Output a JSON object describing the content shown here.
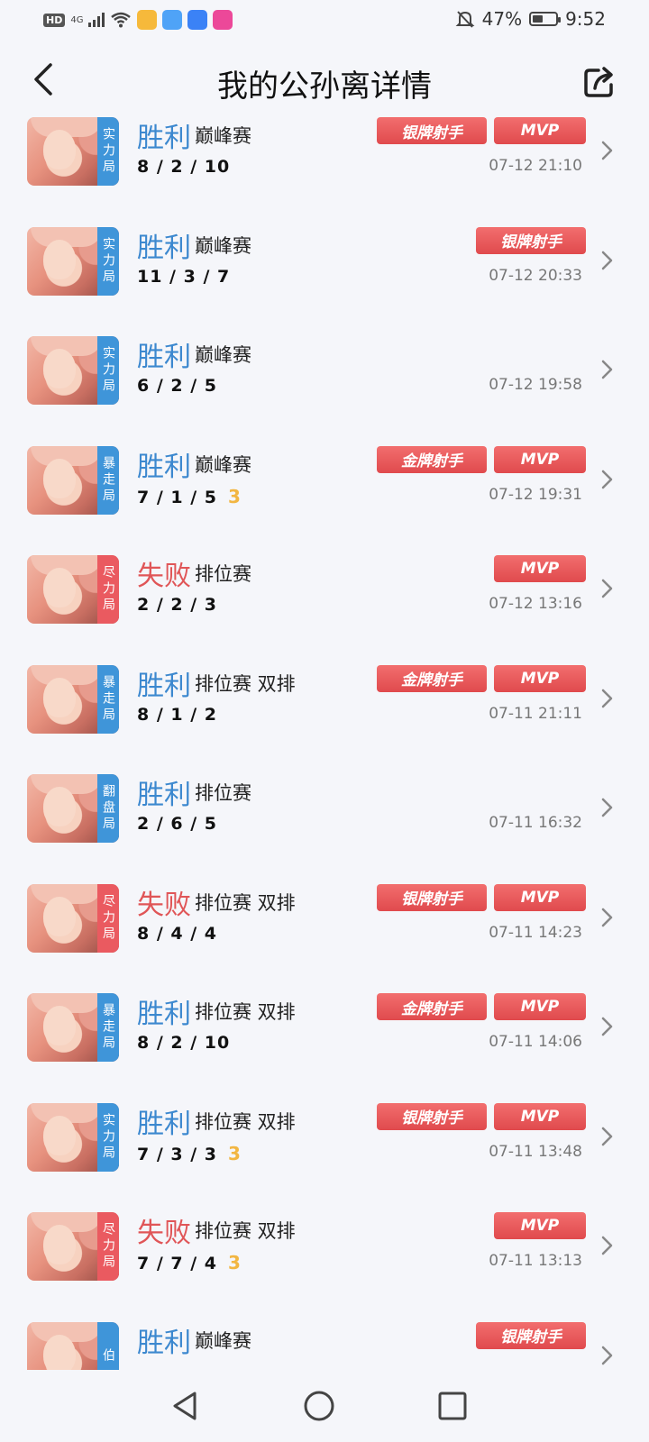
{
  "status": {
    "left_badge": "HD",
    "network": "4G",
    "battery": "47%",
    "battery_level": 0.47,
    "time": "9:52",
    "app_icon_colors": [
      "#f6b93b",
      "#4fa3f7",
      "#3b82f6",
      "#ec4899"
    ]
  },
  "header": {
    "title": "我的公孙离详情"
  },
  "matches": [
    {
      "result": "胜利",
      "win": true,
      "mode": "巅峰赛",
      "kda": "8 / 2 / 10",
      "three": "",
      "tag": "实力局",
      "tag_color": "blue",
      "medal": "银牌射手",
      "mvp": "MVP",
      "time": "07-12 21:10"
    },
    {
      "result": "胜利",
      "win": true,
      "mode": "巅峰赛",
      "kda": "11 / 3 / 7",
      "three": "",
      "tag": "实力局",
      "tag_color": "blue",
      "medal": "银牌射手",
      "mvp": "",
      "time": "07-12 20:33"
    },
    {
      "result": "胜利",
      "win": true,
      "mode": "巅峰赛",
      "kda": "6 / 2 / 5",
      "three": "",
      "tag": "实力局",
      "tag_color": "blue",
      "medal": "",
      "mvp": "",
      "time": "07-12 19:58"
    },
    {
      "result": "胜利",
      "win": true,
      "mode": "巅峰赛",
      "kda": "7 / 1 / 5",
      "three": "3",
      "tag": "暴走局",
      "tag_color": "blue",
      "medal": "金牌射手",
      "mvp": "MVP",
      "time": "07-12 19:31"
    },
    {
      "result": "失败",
      "win": false,
      "mode": "排位赛",
      "kda": "2 / 2 / 3",
      "three": "",
      "tag": "尽力局",
      "tag_color": "red",
      "medal": "",
      "mvp": "MVP",
      "time": "07-12 13:16"
    },
    {
      "result": "胜利",
      "win": true,
      "mode": "排位赛 双排",
      "kda": "8 / 1 / 2",
      "three": "",
      "tag": "暴走局",
      "tag_color": "blue",
      "medal": "金牌射手",
      "mvp": "MVP",
      "time": "07-11 21:11"
    },
    {
      "result": "胜利",
      "win": true,
      "mode": "排位赛",
      "kda": "2 / 6 / 5",
      "three": "",
      "tag": "翻盘局",
      "tag_color": "blue",
      "medal": "",
      "mvp": "",
      "time": "07-11 16:32"
    },
    {
      "result": "失败",
      "win": false,
      "mode": "排位赛 双排",
      "kda": "8 / 4 / 4",
      "three": "",
      "tag": "尽力局",
      "tag_color": "red",
      "medal": "银牌射手",
      "mvp": "MVP",
      "time": "07-11 14:23"
    },
    {
      "result": "胜利",
      "win": true,
      "mode": "排位赛 双排",
      "kda": "8 / 2 / 10",
      "three": "",
      "tag": "暴走局",
      "tag_color": "blue",
      "medal": "金牌射手",
      "mvp": "MVP",
      "time": "07-11 14:06"
    },
    {
      "result": "胜利",
      "win": true,
      "mode": "排位赛 双排",
      "kda": "7 / 3 / 3",
      "three": "3",
      "tag": "实力局",
      "tag_color": "blue",
      "medal": "银牌射手",
      "mvp": "MVP",
      "time": "07-11 13:48"
    },
    {
      "result": "失败",
      "win": false,
      "mode": "排位赛 双排",
      "kda": "7 / 7 / 4",
      "three": "3",
      "tag": "尽力局",
      "tag_color": "red",
      "medal": "",
      "mvp": "MVP",
      "time": "07-11 13:13"
    },
    {
      "result": "胜利",
      "win": true,
      "mode": "巅峰赛",
      "kda": "",
      "three": "",
      "tag": "伯",
      "tag_color": "blue",
      "medal": "银牌射手",
      "mvp": "",
      "time": ""
    }
  ],
  "nav": {
    "back_icon": "triangle-back-icon",
    "home_icon": "circle-home-icon",
    "recent_icon": "square-recent-icon"
  }
}
